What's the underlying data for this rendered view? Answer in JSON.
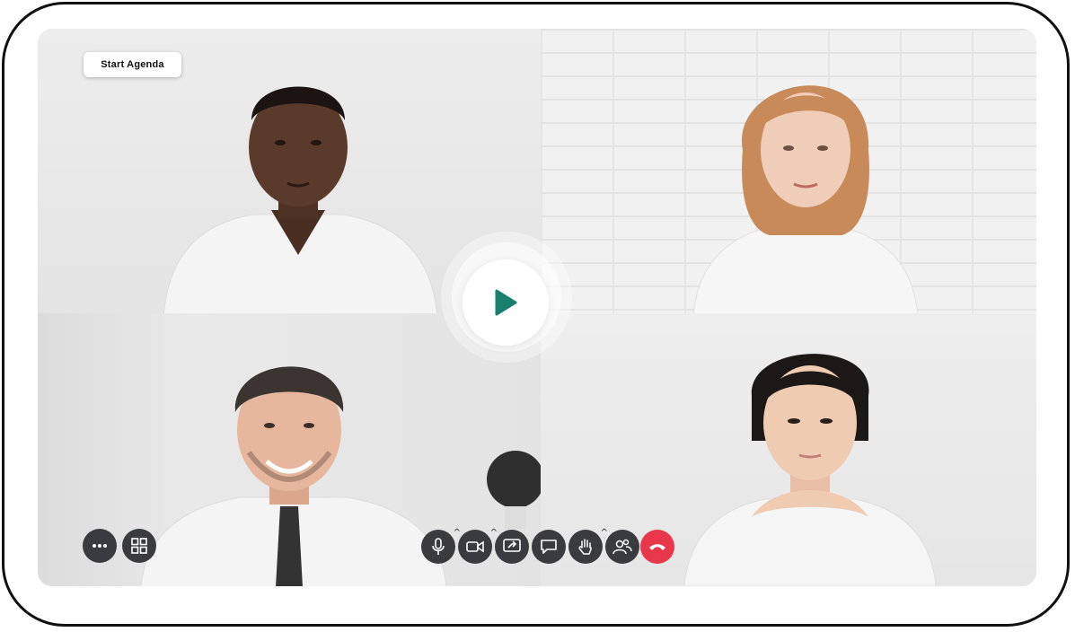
{
  "agenda": {
    "label": "Start Agenda"
  },
  "participants": [
    {
      "name": "",
      "shirt": "#f4f4f4",
      "skin": "#5a3a2a"
    },
    {
      "name": "",
      "shirt": "#f6f6f6",
      "skin": "#f0cdb8"
    },
    {
      "name": "",
      "shirt": "#f4f4f4",
      "skin": "#e6b79c"
    },
    {
      "name": "",
      "shirt": "#f5f5f5",
      "skin": "#efcbb2"
    }
  ],
  "controls": {
    "left": [
      {
        "icon": "more-icon"
      },
      {
        "icon": "grid-layout-icon"
      }
    ],
    "center": [
      {
        "icon": "microphone-icon",
        "has_caret": true
      },
      {
        "icon": "video-camera-icon",
        "has_caret": true
      },
      {
        "icon": "share-screen-icon",
        "has_caret": false
      },
      {
        "icon": "chat-icon",
        "has_caret": false
      },
      {
        "icon": "raise-hand-icon",
        "has_caret": true
      },
      {
        "icon": "participants-icon",
        "has_caret": false
      },
      {
        "icon": "end-call-icon",
        "has_caret": false
      }
    ],
    "caret_glyph": "^"
  },
  "colors": {
    "control_bg": "#3a3b3e",
    "end_call": "#e8364a",
    "play_icon": "#1a7f6c"
  }
}
